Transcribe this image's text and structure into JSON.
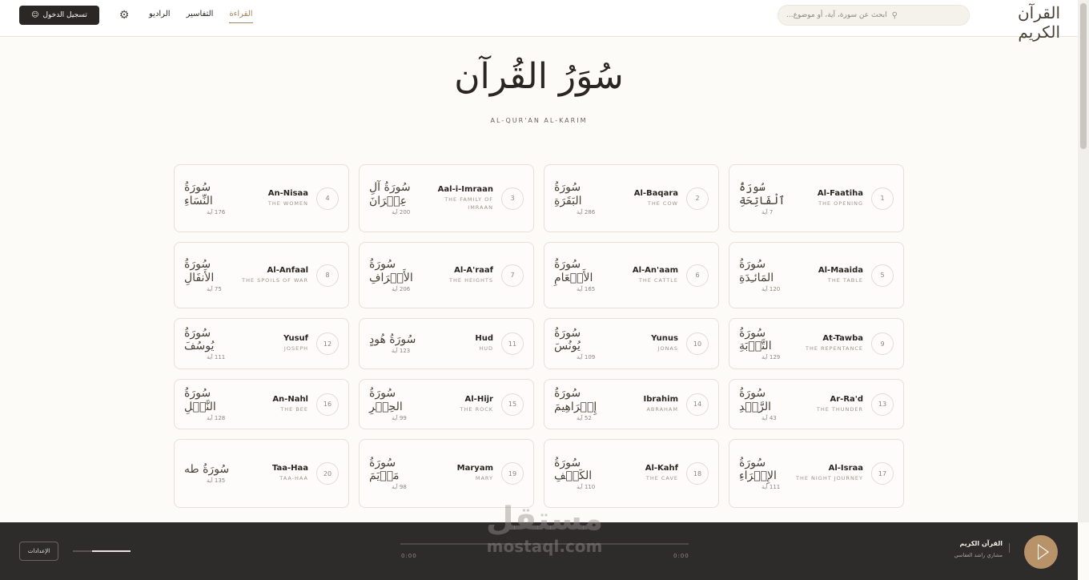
{
  "header": {
    "brand": "القرآن الكريم",
    "search_placeholder": "ابحث عن سورة، آية، أو موضوع...",
    "login_label": "تسجيل الدخول",
    "nav": [
      {
        "label": "القراءة",
        "active": true
      },
      {
        "label": "التفاسير",
        "active": false
      },
      {
        "label": "الراديو",
        "active": false
      }
    ],
    "icons": {
      "search": "search-icon",
      "settings": "gear-icon",
      "user": "user-icon"
    }
  },
  "hero": {
    "title": "سُوَرُ القُرآن",
    "subtitle": "AL-QUR'AN AL-KARIM"
  },
  "surahs": [
    {
      "num": "1",
      "en": "Al-Faatiha",
      "meaning": "THE OPENING",
      "ar": "سُورَةُ ٱلْفَاتِحَةِ",
      "ayahs": "7 آية"
    },
    {
      "num": "2",
      "en": "Al-Baqara",
      "meaning": "THE COW",
      "ar": "سُورَةُ البَقَرَةِ",
      "ayahs": "286 آية"
    },
    {
      "num": "3",
      "en": "Aal-i-Imraan",
      "meaning": "THE FAMILY OF IMRAAN",
      "ar": "سُورَةُ آلِ عِمۡرَانَ",
      "ayahs": "200 آية"
    },
    {
      "num": "4",
      "en": "An-Nisaa",
      "meaning": "THE WOMEN",
      "ar": "سُورَةُ النِّسَاءِ",
      "ayahs": "176 آية"
    },
    {
      "num": "5",
      "en": "Al-Maaida",
      "meaning": "THE TABLE",
      "ar": "سُورَةُ المَائـِدَةِ",
      "ayahs": "120 آية"
    },
    {
      "num": "6",
      "en": "Al-An'aam",
      "meaning": "THE CATTLE",
      "ar": "سُورَةُ الأَنۡعَامِ",
      "ayahs": "165 آية"
    },
    {
      "num": "7",
      "en": "Al-A'raaf",
      "meaning": "THE HEIGHTS",
      "ar": "سُورَةُ الأَعۡرَافِ",
      "ayahs": "206 آية"
    },
    {
      "num": "8",
      "en": "Al-Anfaal",
      "meaning": "THE SPOILS OF WAR",
      "ar": "سُورَةُ الأَنفَالِ",
      "ayahs": "75 آية"
    },
    {
      "num": "9",
      "en": "At-Tawba",
      "meaning": "THE REPENTANCE",
      "ar": "سُورَةُ التَّوۡبَةِ",
      "ayahs": "129 آية"
    },
    {
      "num": "10",
      "en": "Yunus",
      "meaning": "JONAS",
      "ar": "سُورَةُ يُونُسَ",
      "ayahs": "109 آية"
    },
    {
      "num": "11",
      "en": "Hud",
      "meaning": "HUD",
      "ar": "سُورَةُ هُودٍ",
      "ayahs": "123 آية"
    },
    {
      "num": "12",
      "en": "Yusuf",
      "meaning": "JOSEPH",
      "ar": "سُورَةُ يُوسُفَ",
      "ayahs": "111 آية"
    },
    {
      "num": "13",
      "en": "Ar-Ra'd",
      "meaning": "THE THUNDER",
      "ar": "سُورَةُ الرَّعۡدِ",
      "ayahs": "43 آية"
    },
    {
      "num": "14",
      "en": "Ibrahim",
      "meaning": "ABRAHAM",
      "ar": "سُورَةُ إِبۡرَاهِيمَ",
      "ayahs": "52 آية"
    },
    {
      "num": "15",
      "en": "Al-Hijr",
      "meaning": "THE ROCK",
      "ar": "سُورَةُ الحِجۡرِ",
      "ayahs": "99 آية"
    },
    {
      "num": "16",
      "en": "An-Nahl",
      "meaning": "THE BEE",
      "ar": "سُورَةُ النَّحۡلِ",
      "ayahs": "128 آية"
    },
    {
      "num": "17",
      "en": "Al-Israa",
      "meaning": "THE NIGHT JOURNEY",
      "ar": "سُورَةُ الإِسۡرَاءِ",
      "ayahs": "111 آية"
    },
    {
      "num": "18",
      "en": "Al-Kahf",
      "meaning": "THE CAVE",
      "ar": "سُورَةُ الكَهۡفِ",
      "ayahs": "110 آية"
    },
    {
      "num": "19",
      "en": "Maryam",
      "meaning": "MARY",
      "ar": "سُورَةُ مَرۡيَمَ",
      "ayahs": "98 آية"
    },
    {
      "num": "20",
      "en": "Taa-Haa",
      "meaning": "TAA-HAA",
      "ar": "سُورَةُ طه",
      "ayahs": "135 آية"
    }
  ],
  "player": {
    "settings_label": "الإعدادات",
    "volume_level": 0.67,
    "progress": 0,
    "time_current": "0:00",
    "time_total": "0:00",
    "track_title": "القرآن الكريم",
    "reciter": "مشاري راشد العفاسي",
    "play_icon": "play-icon"
  },
  "watermark": {
    "arabic": "مستقل",
    "latin": "mostaql.com"
  },
  "colors": {
    "accent": "#a4845a",
    "play": "#b8936a",
    "player_bg": "#2e2c2a",
    "page_bg": "#fcfbf8"
  }
}
